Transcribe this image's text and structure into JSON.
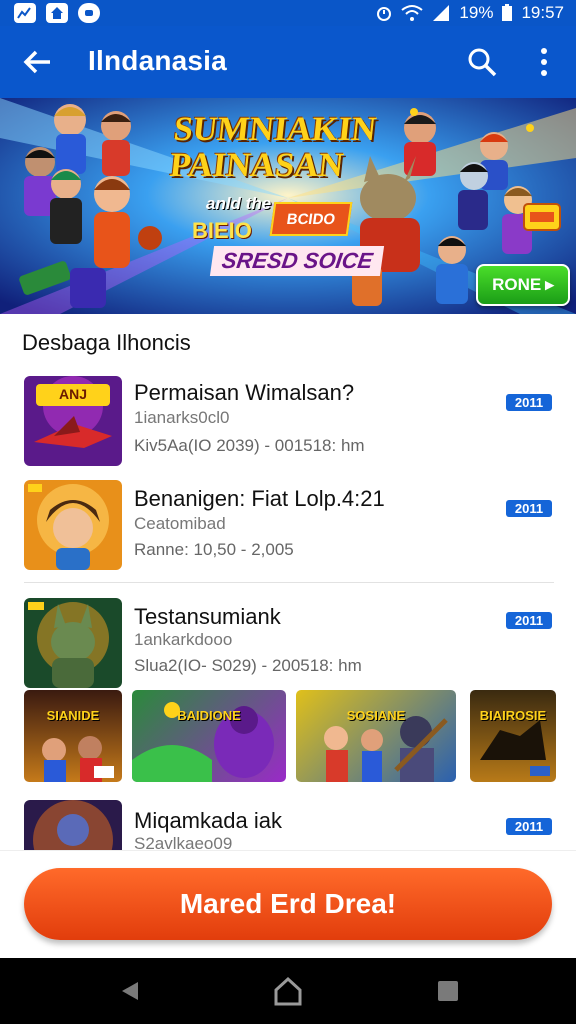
{
  "status": {
    "left_icons": [
      "chart-icon",
      "home-icon",
      "chat-icon"
    ],
    "battery": "19%",
    "time": "19:57"
  },
  "appbar": {
    "title": "Ilndanasia",
    "back_icon": "arrow-left-icon",
    "search_icon": "search-icon",
    "more_icon": "more-vert-icon"
  },
  "banner": {
    "title_line1": "SUMNIAKIN",
    "title_line2": "PAINASAN",
    "sub": "anld the",
    "tag1": "BIEIO",
    "tag2": "BCIDO",
    "sub2": "SRESD SOICE",
    "button": "RONE"
  },
  "section": {
    "title": "Desbaga Ilhoncis"
  },
  "items": [
    {
      "title": "Permaisan Wimalsan?",
      "subtitle": "1ianarks0cl0",
      "meta": "Kiv5Aa(IO   2039) - 001518:    hm",
      "badge": "2011",
      "thumb_label": "ANJ"
    },
    {
      "title": "Benanigen: Fiat Lolp.4:21",
      "subtitle": "Ceatomibad",
      "meta": "Ranne:   10,50 - 2,005",
      "badge": "2011",
      "thumb_label": ""
    },
    {
      "title": "Testansumiank",
      "subtitle": "1ankarkdooo",
      "meta": "Slua2(IO-   S029) - 200518:    hm",
      "badge": "2011",
      "thumb_label": ""
    },
    {
      "title": "Miqamkada iak",
      "subtitle": "S2avlkaeo09",
      "meta": "",
      "badge": "2011",
      "thumb_label": ""
    }
  ],
  "mini_games": [
    {
      "label": "SIANIDE",
      "colors": [
        "#3a1a10",
        "#c57a1a"
      ]
    },
    {
      "label": "BAIDIONE",
      "colors": [
        "#2a8a3a",
        "#9a2ac8"
      ]
    },
    {
      "label": "SOSIANE",
      "colors": [
        "#e0c01a",
        "#2a60b0"
      ]
    },
    {
      "label": "BIAIROSIE",
      "colors": [
        "#3a2a10",
        "#b87a18"
      ]
    }
  ],
  "cta": {
    "label": "Mared Erd Drea!"
  },
  "colors": {
    "primary": "#0a57cc",
    "cta": "#e84a12",
    "badge": "#1565d8"
  }
}
